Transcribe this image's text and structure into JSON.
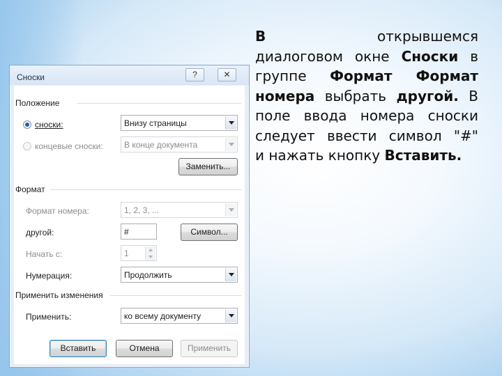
{
  "dialog": {
    "title": "Сноски",
    "help_button": "?",
    "close_button": "✕",
    "position_group": "Положение",
    "footnotes_label": "сноски:",
    "footnotes_value": "Внизу страницы",
    "endnotes_label": "концевые сноски:",
    "endnotes_value": "В конце документа",
    "replace_button": "Заменить...",
    "format_group": "Формат",
    "number_format_label": "Формат номера:",
    "number_format_value": "1, 2, 3, ...",
    "custom_label": "другой:",
    "custom_value": "#",
    "symbol_button": "Символ...",
    "start_label": "Начать с:",
    "start_value": "1",
    "numbering_label": "Нумерация:",
    "numbering_value": "Продолжить",
    "apply_group": "Применить изменения",
    "apply_label": "Применить:",
    "apply_value": "ко всему документу",
    "insert_button": "Вставить",
    "cancel_button": "Отмена",
    "apply_button": "Применить"
  },
  "slide_text": {
    "l1a": "В",
    "l1b": "открывшемся",
    "l2a": "диалоговом окне ",
    "l2b": "Сноски",
    "l2c": " в",
    "l3a": "группе ",
    "l3b": "Формат Формат",
    "l4a": "номера",
    "l4b": " выбрать ",
    "l4c": "другой.",
    "l4d": " В",
    "l5": "поле ввода номера сноски",
    "l6": "следует ввести символ \"#\"",
    "l7a": "и нажать кнопку ",
    "l7b": "Вставить."
  },
  "colors": {
    "background": "#96c5ec",
    "dialog_frame": "#e6eef8",
    "default_button_border": "#3c7fb1"
  }
}
